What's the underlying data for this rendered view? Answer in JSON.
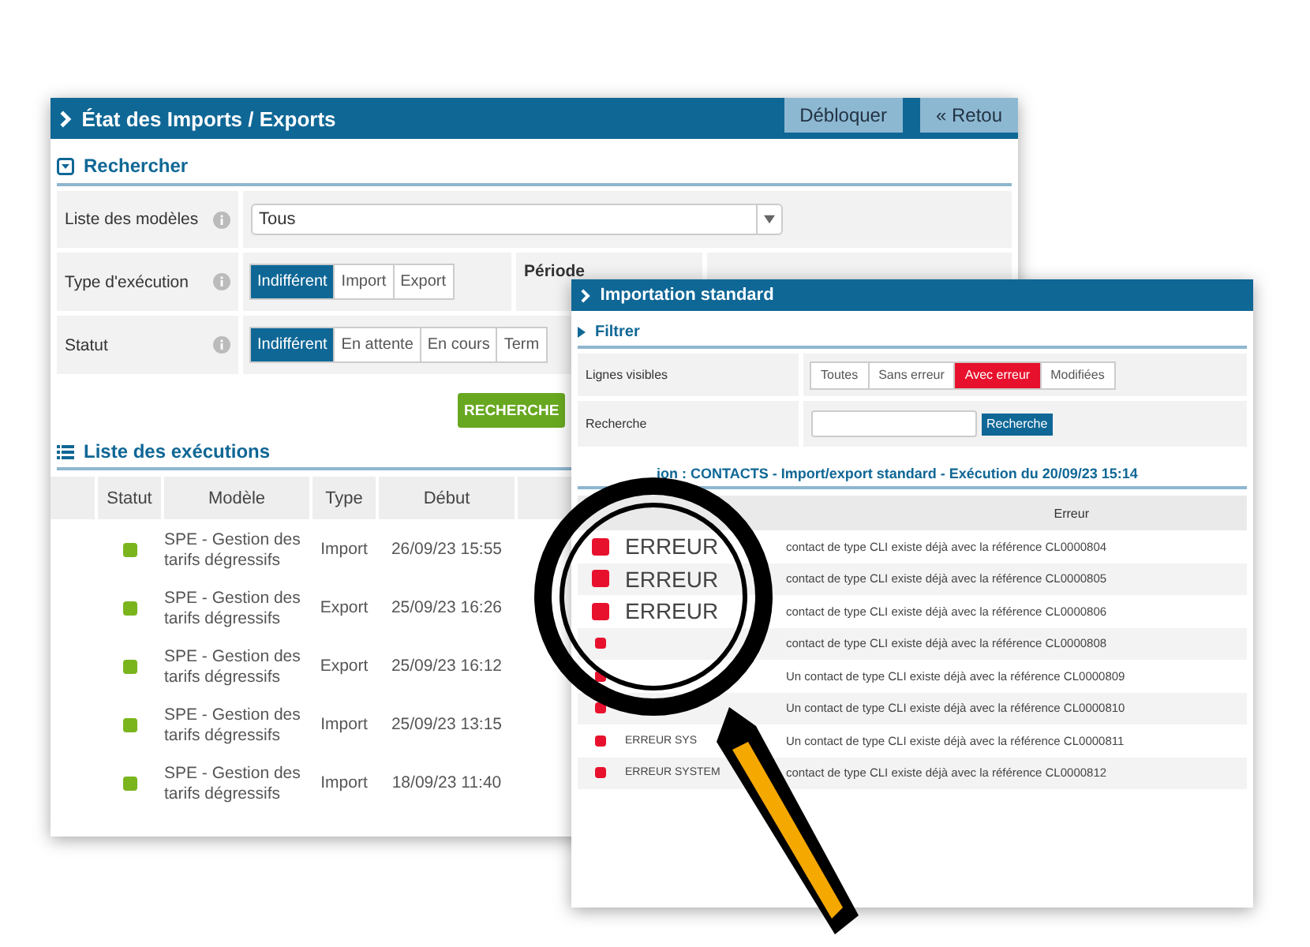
{
  "back_window": {
    "title": "État des Imports / Exports",
    "buttons": [
      "Débloquer",
      "« Retou"
    ],
    "search_section": {
      "title": "Rechercher",
      "expanded": true
    },
    "fields": [
      {
        "kind": "select",
        "label": "Liste des modèles",
        "value": "Tous"
      },
      {
        "kind": "segmented",
        "label": "Type d'exécution",
        "options": [
          {
            "label": "Indifférent",
            "selected": true
          },
          {
            "label": "Import",
            "selected": false
          },
          {
            "label": "Export",
            "selected": false
          }
        ],
        "extra_label": "Période"
      },
      {
        "kind": "segmented",
        "label": "Statut",
        "options": [
          {
            "label": "Indifférent",
            "selected": true
          },
          {
            "label": "En attente",
            "selected": false
          },
          {
            "label": "En cours",
            "selected": false
          },
          {
            "label": "Term",
            "selected": false
          }
        ]
      }
    ],
    "search_button": "RECHERCHE",
    "list_title": "Liste des exécutions",
    "table": {
      "columns": [
        "Statut",
        "Modèle",
        "Type",
        "Début"
      ],
      "rows": [
        {
          "color": "#7ab51d",
          "model": "SPE - Gestion des tarifs dégressifs",
          "type": "Import",
          "start": "26/09/23 15:55"
        },
        {
          "color": "#7ab51d",
          "model": "SPE - Gestion des tarifs dégressifs",
          "type": "Export",
          "start": "25/09/23 16:26"
        },
        {
          "color": "#7ab51d",
          "model": "SPE - Gestion des tarifs dégressifs",
          "type": "Export",
          "start": "25/09/23 16:12"
        },
        {
          "color": "#7ab51d",
          "model": "SPE - Gestion des tarifs dégressifs",
          "type": "Import",
          "start": "25/09/23 13:15"
        },
        {
          "color": "#7ab51d",
          "model": "SPE - Gestion des tarifs dégressifs",
          "type": "Import",
          "start": "18/09/23 11:40"
        }
      ]
    }
  },
  "front_window": {
    "title": "Importation standard",
    "filter_title": "Filtrer",
    "visible_lines": {
      "label": "Lignes visibles",
      "options": [
        {
          "label": "Toutes",
          "selected": false
        },
        {
          "label": "Sans erreur",
          "selected": false
        },
        {
          "label": "Avec erreur",
          "selected": true
        },
        {
          "label": "Modifiées",
          "selected": false
        }
      ]
    },
    "search": {
      "label": "Recherche",
      "button": "Recherche"
    },
    "execution_title": "ion : CONTACTS - Import/export standard - Exécution du 20/09/23 15:14",
    "error_column": "Erreur",
    "rows": [
      {
        "color": "#e8112d",
        "code": "ERREUR",
        "magnified": true,
        "message": "contact de type CLI existe déjà avec la référence CL0000804"
      },
      {
        "color": "#e8112d",
        "code": "ERREUR",
        "magnified": true,
        "message": "contact de type CLI existe déjà avec la référence CL0000805"
      },
      {
        "color": "#e8112d",
        "code": "ERREUR",
        "magnified": true,
        "message": "contact de type CLI existe déjà avec la référence CL0000806"
      },
      {
        "color": "#e8112d",
        "message": "contact de type CLI existe déjà avec la référence CL0000808"
      },
      {
        "color": "#e8112d",
        "message": "Un contact de type CLI existe déjà avec la référence CL0000809"
      },
      {
        "color": "#e8112d",
        "message": "Un contact de type CLI existe déjà avec la référence CL0000810"
      },
      {
        "color": "#e8112d",
        "code": "ERREUR SYS",
        "magnified": false,
        "message": "Un contact de type CLI existe déjà avec la référence CL0000811"
      },
      {
        "color": "#e8112d",
        "code": "ERREUR SYSTEM",
        "magnified": false,
        "message": "contact de type CLI existe déjà avec la référence CL0000812"
      }
    ]
  }
}
